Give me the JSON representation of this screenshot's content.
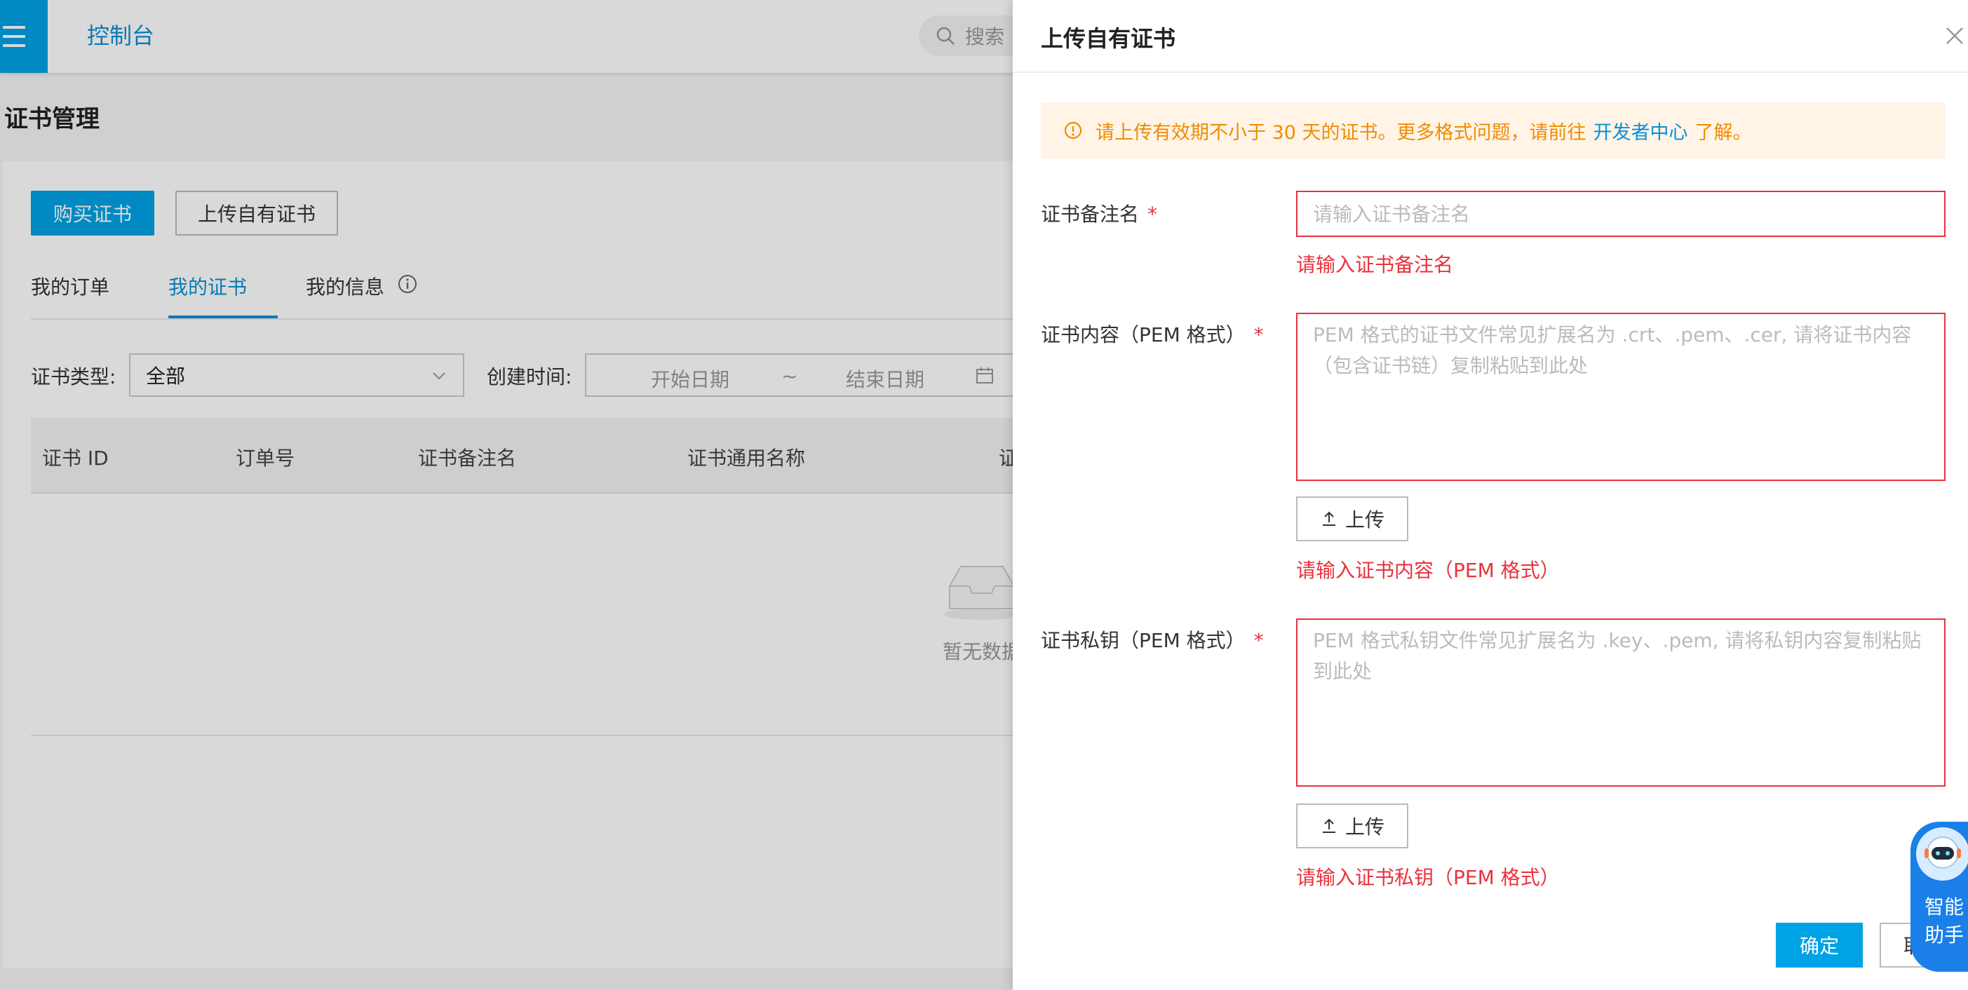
{
  "topbar": {
    "title": "控制台",
    "search_placeholder": "搜索"
  },
  "page": {
    "title": "证书管理",
    "buy_button": "购买证书",
    "upload_button": "上传自有证书",
    "tabs": [
      {
        "label": "我的订单",
        "active": false
      },
      {
        "label": "我的证书",
        "active": true
      },
      {
        "label": "我的信息",
        "active": false
      }
    ],
    "filters": {
      "cert_type_label": "证书类型:",
      "cert_type_value": "全部",
      "created_label": "创建时间:",
      "start_placeholder": "开始日期",
      "range_separator": "~",
      "end_placeholder": "结束日期"
    },
    "table": {
      "columns": [
        "证书 ID",
        "订单号",
        "证书备注名",
        "证书通用名称",
        "证"
      ],
      "empty_text": "暂无数据"
    }
  },
  "drawer": {
    "title": "上传自有证书",
    "alert": {
      "text_before": "请上传有效期不小于 30 天的证书。更多格式问题，请前往",
      "link": "开发者中心",
      "text_after": "了解。"
    },
    "fields": {
      "name": {
        "label": "证书备注名",
        "placeholder": "请输入证书备注名",
        "value": "",
        "error": "请输入证书备注名"
      },
      "content": {
        "label": "证书内容（PEM 格式）",
        "placeholder": "PEM 格式的证书文件常见扩展名为 .crt、.pem、.cer, 请将证书内容（包含证书链）复制粘贴到此处",
        "value": "",
        "upload_label": "上传",
        "error": "请输入证书内容（PEM 格式）"
      },
      "key": {
        "label": "证书私钥（PEM 格式）",
        "placeholder": "PEM 格式私钥文件常见扩展名为 .key、.pem, 请将私钥内容复制粘贴到此处",
        "value": "",
        "upload_label": "上传",
        "error": "请输入证书私钥（PEM 格式）"
      }
    },
    "required_mark": "*",
    "confirm_button": "确定",
    "cancel_button": "取消"
  },
  "assistant": {
    "label": "智能助手"
  },
  "colors": {
    "primary": "#00a2e6",
    "link": "#0a90d6",
    "error": "#e8323c",
    "warning_text": "#f08c00",
    "warning_bg": "#fff4e6"
  }
}
